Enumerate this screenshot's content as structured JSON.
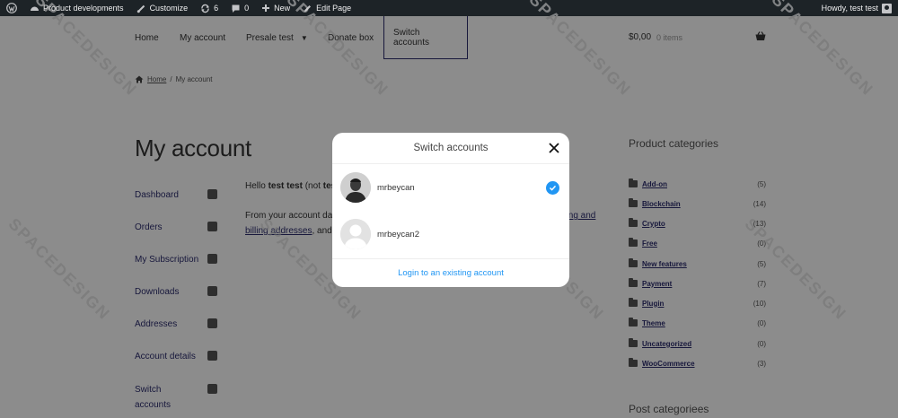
{
  "admin_bar": {
    "site_name": "Product developments",
    "customize": "Customize",
    "updates_count": "6",
    "comments_count": "0",
    "new_label": "New",
    "edit_page": "Edit Page",
    "howdy": "Howdy, test test"
  },
  "nav": {
    "home": "Home",
    "my_account": "My account",
    "presale": "Presale test",
    "donate": "Donate box",
    "switch_accounts": "Switch accounts",
    "cart_total": "$0,00",
    "cart_items": "0 items"
  },
  "breadcrumb": {
    "home": "Home",
    "separator": "/",
    "current": "My account"
  },
  "page_title": "My account",
  "account_nav": [
    {
      "label": "Dashboard"
    },
    {
      "label": "Orders"
    },
    {
      "label": "My Subscription"
    },
    {
      "label": "Downloads"
    },
    {
      "label": "Addresses"
    },
    {
      "label": "Account details"
    },
    {
      "label": "Switch"
    },
    {
      "label": "accounts"
    }
  ],
  "content": {
    "hello_prefix": "Hello ",
    "hello_name": "test test",
    "hello_rest": " (not ",
    "hello_tail": "tes",
    "line2_start": "From your account da",
    "line2_link": "ping and",
    "line3_link": "billing addresses",
    "line3_rest": ", and"
  },
  "sidebar": {
    "product_categories_title": "Product categories",
    "categories": [
      {
        "name": "Add-on",
        "count": "(5)"
      },
      {
        "name": "Blockchain",
        "count": "(14)"
      },
      {
        "name": "Crypto",
        "count": "(13)"
      },
      {
        "name": "Free",
        "count": "(0)"
      },
      {
        "name": "New features",
        "count": "(5)"
      },
      {
        "name": "Payment",
        "count": "(7)"
      },
      {
        "name": "Plugin",
        "count": "(10)"
      },
      {
        "name": "Theme",
        "count": "(0)"
      },
      {
        "name": "Uncategorized",
        "count": "(0)"
      },
      {
        "name": "WooCommerce",
        "count": "(3)"
      }
    ],
    "post_categories_title": "Post categoriees"
  },
  "watermark": "SPACEDESIGN",
  "modal": {
    "title": "Switch accounts",
    "accounts": [
      {
        "name": "mrbeycan",
        "selected": true
      },
      {
        "name": "mrbeycan2",
        "selected": false
      }
    ],
    "login_link": "Login to an existing account"
  },
  "colors": {
    "admin_bar": "#1d2327",
    "link": "#2c2d6e",
    "accent_blue": "#2196f3"
  }
}
